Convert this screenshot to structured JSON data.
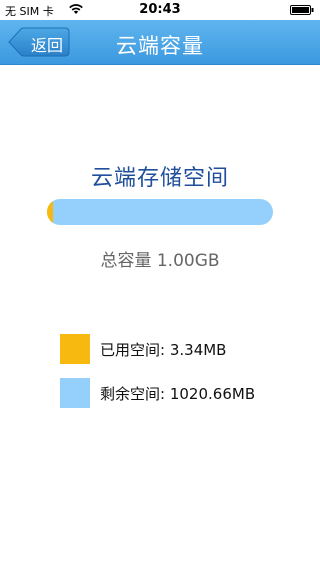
{
  "status_bar": {
    "carrier": "无 SIM 卡",
    "time": "20:43"
  },
  "nav": {
    "back_label": "返回",
    "title": "云端容量"
  },
  "storage": {
    "title": "云端存储空间",
    "total_label": "总容量",
    "total_value": "1.00GB",
    "used_fraction": 0.0033,
    "used_label": "已用空间:",
    "used_value": "3.34MB",
    "remaining_label": "剩余空间:",
    "remaining_value": "1020.66MB"
  },
  "colors": {
    "nav_bar": "#4aa7e8",
    "used": "#f7b810",
    "remaining": "#94d0fb",
    "title_text": "#1f4f9a"
  },
  "icons": {
    "wifi": "wifi-icon",
    "battery": "battery-icon",
    "back": "back-arrow-icon"
  }
}
